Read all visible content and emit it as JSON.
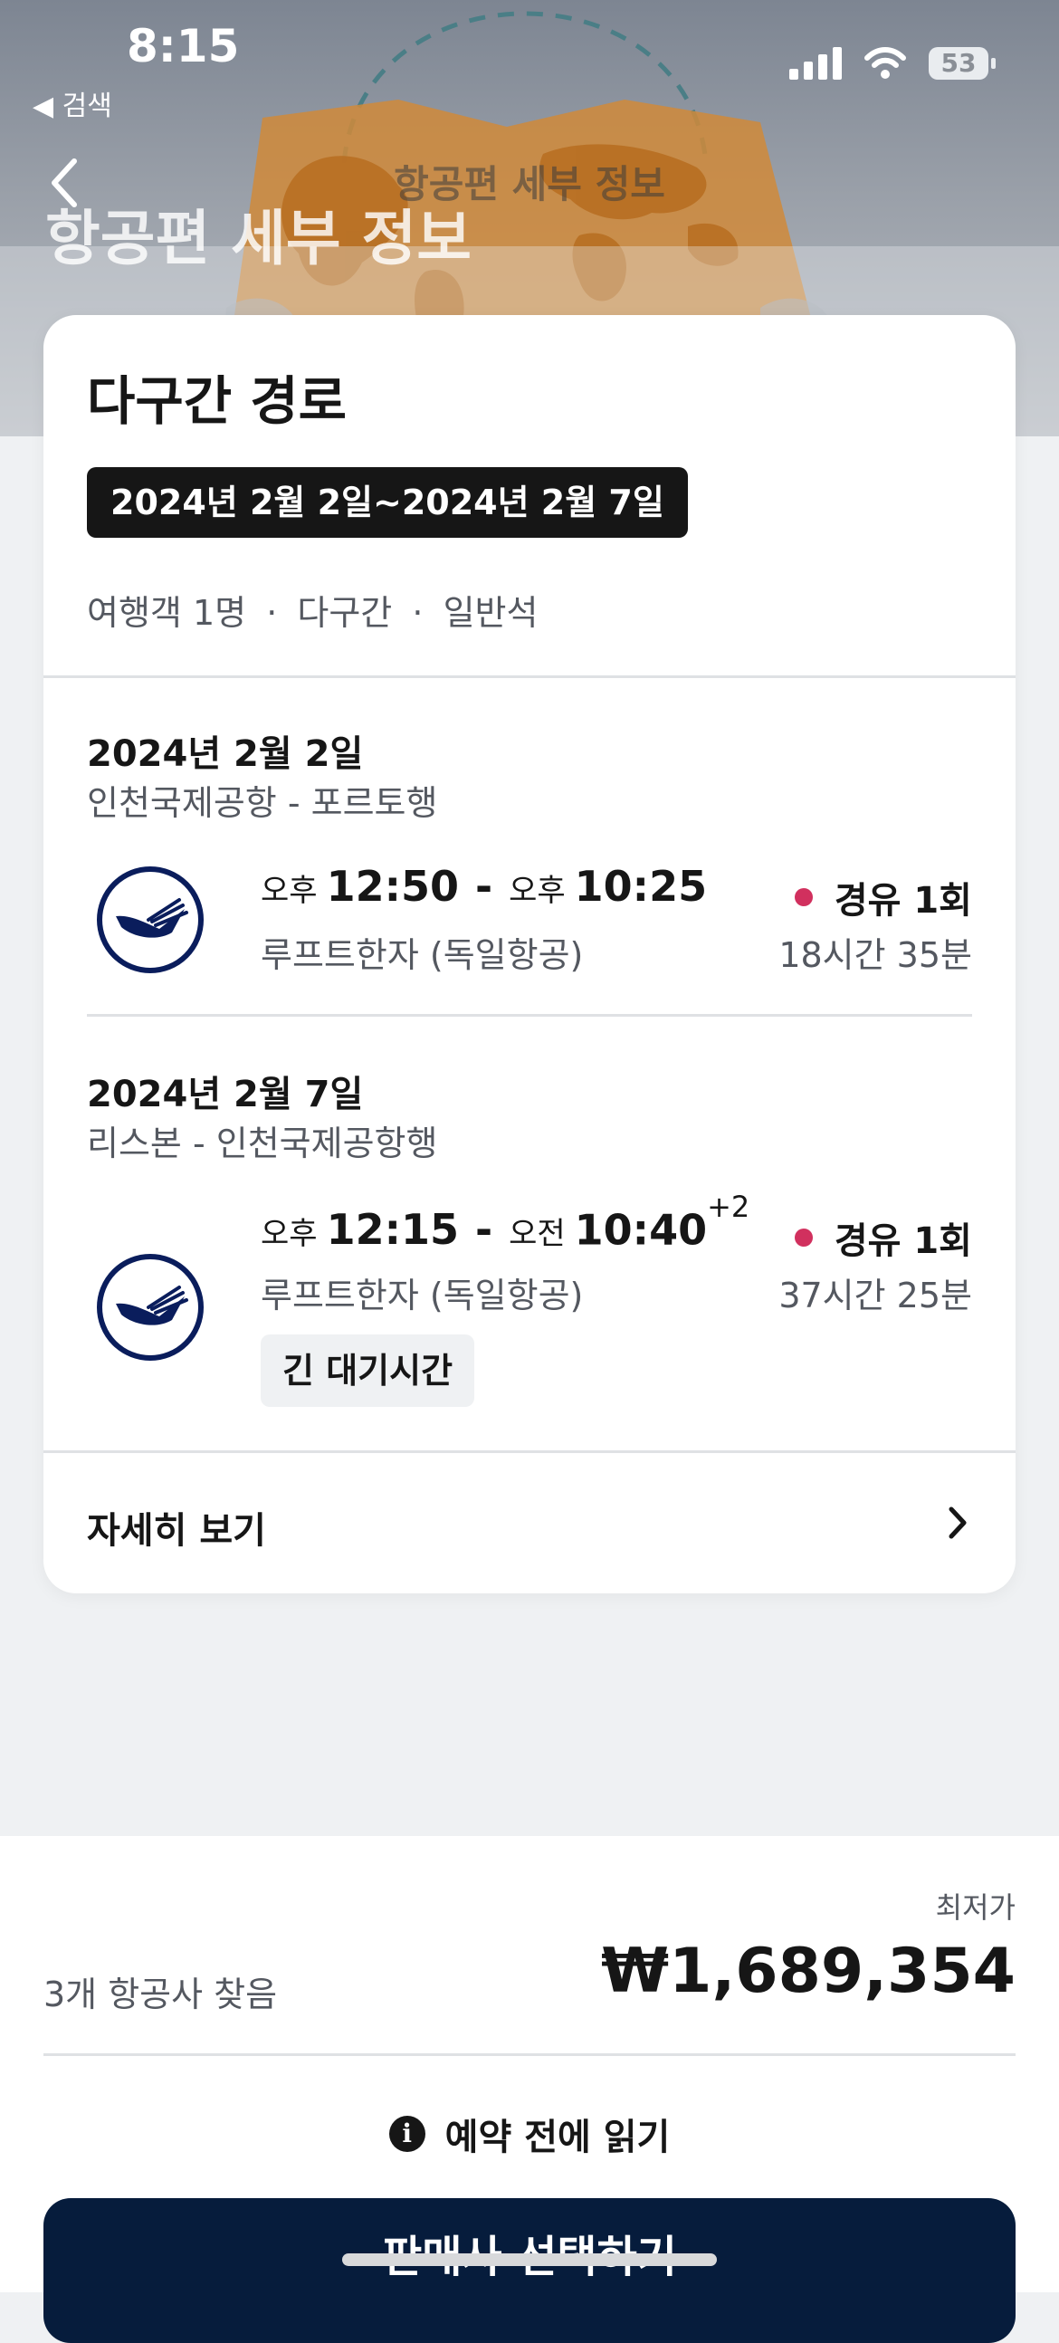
{
  "status_bar": {
    "time": "8:15",
    "back_label": "◀ 검색",
    "battery": "53",
    "icons": [
      "signal-icon",
      "wifi-icon",
      "battery-icon"
    ]
  },
  "nav": {
    "title_small": "항공편 세부 정보",
    "title_large": "항공편 세부 정보",
    "back_icon": "chevron-left-icon"
  },
  "card": {
    "title": "다구간 경로",
    "date_range": "2024년 2월 2일~2024년 2월 7일",
    "meta": [
      "여행객 1명",
      "다구간",
      "일반석"
    ],
    "meta_separator": "·",
    "segments": [
      {
        "date": "2024년 2월 2일",
        "route": "인천국제공항 - 포르토행",
        "depart_ampm": "오후",
        "depart_time": "12:50",
        "arrive_ampm": "오후",
        "arrive_time": "10:25",
        "day_offset": "",
        "airline": "루프트한자 (독일항공)",
        "stops": "경유 1회",
        "duration": "18시간 35분"
      },
      {
        "date": "2024년 2월 7일",
        "route": "리스본 - 인천국제공항행",
        "depart_ampm": "오후",
        "depart_time": "12:15",
        "arrive_ampm": "오전",
        "arrive_time": "10:40",
        "day_offset": "+2",
        "airline": "루프트한자 (독일항공)",
        "stops": "경유 1회",
        "duration": "37시간 25분",
        "tag": "긴 대기시간"
      }
    ],
    "details_label": "자세히 보기"
  },
  "footer": {
    "lowest_label": "최저가",
    "found_text": "3개 항공사 찾음",
    "price": "₩1,689,354",
    "read_before": "예약 전에 읽기",
    "cta_label": "판매사 선택하기"
  },
  "colors": {
    "stop_dot": "#d1305e",
    "cta_background": "#061c3c",
    "lufthansa_navy": "#0a1d5c"
  }
}
